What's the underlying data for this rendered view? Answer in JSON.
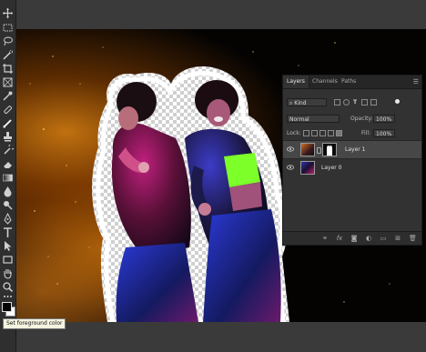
{
  "tooltip": {
    "text": "Set foreground color"
  },
  "layers_panel": {
    "tabs": [
      {
        "label": "Layers",
        "active": true
      },
      {
        "label": "Channels",
        "active": false
      },
      {
        "label": "Paths",
        "active": false
      }
    ],
    "filter": {
      "label": "Kind"
    },
    "blend_mode": "Normal",
    "opacity": {
      "label": "Opacity:",
      "value": "100%"
    },
    "lock_label": "Lock:",
    "fill": {
      "label": "Fill:",
      "value": "100%"
    },
    "layers": [
      {
        "name": "Layer 1",
        "selected": true,
        "visible": true,
        "has_mask": true
      },
      {
        "name": "Layer 0",
        "selected": false,
        "visible": true,
        "has_mask": false
      }
    ],
    "footer_icons": [
      "link-icon",
      "fx-icon",
      "mask-icon",
      "adjustment-icon",
      "folder-icon",
      "new-layer-icon",
      "trash-icon"
    ],
    "footer_labels": {
      "fx": "fx"
    }
  },
  "colors": {
    "foreground": "#050505",
    "background": "#ffffff",
    "accent_neon_green": "#7dff2a",
    "accent_magenta": "#d1207a",
    "accent_blue": "#2c3fd8",
    "glow_orange": "#ff8a10"
  },
  "toolbar": {
    "tools": [
      "move-tool",
      "marquee-tool",
      "lasso-tool",
      "quick-select-tool",
      "crop-tool",
      "frame-tool",
      "eyedropper-tool",
      "healing-brush-tool",
      "brush-tool",
      "clone-stamp-tool",
      "history-brush-tool",
      "eraser-tool",
      "gradient-tool",
      "blur-tool",
      "dodge-tool",
      "pen-tool",
      "type-tool",
      "path-select-tool",
      "rectangle-tool",
      "hand-tool",
      "zoom-tool",
      "more-tools"
    ]
  }
}
